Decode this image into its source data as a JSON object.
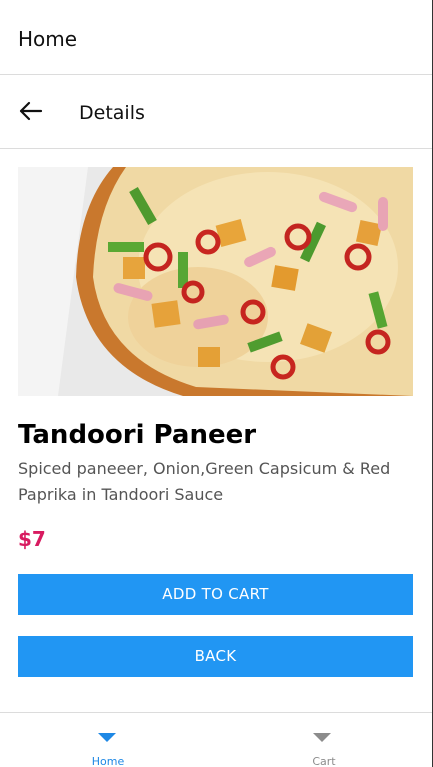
{
  "header": {
    "title": "Home"
  },
  "details_bar": {
    "title": "Details"
  },
  "product": {
    "name": "Tandoori Paneer",
    "description": "Spiced paneeer, Onion,Green Capsicum & Red Paprika in Tandoori Sauce",
    "price": "$7"
  },
  "actions": {
    "add_to_cart": "ADD TO CART",
    "back": "BACK"
  },
  "bottom_nav": {
    "items": [
      {
        "label": "Home",
        "icon": "triangle-down-icon",
        "active": true
      },
      {
        "label": "Cart",
        "icon": "triangle-down-icon",
        "active": false
      }
    ]
  },
  "colors": {
    "accent": "#2196f3",
    "price": "#d81b60",
    "nav_active": "#1e88e5",
    "nav_inactive": "#8c8c8c"
  }
}
